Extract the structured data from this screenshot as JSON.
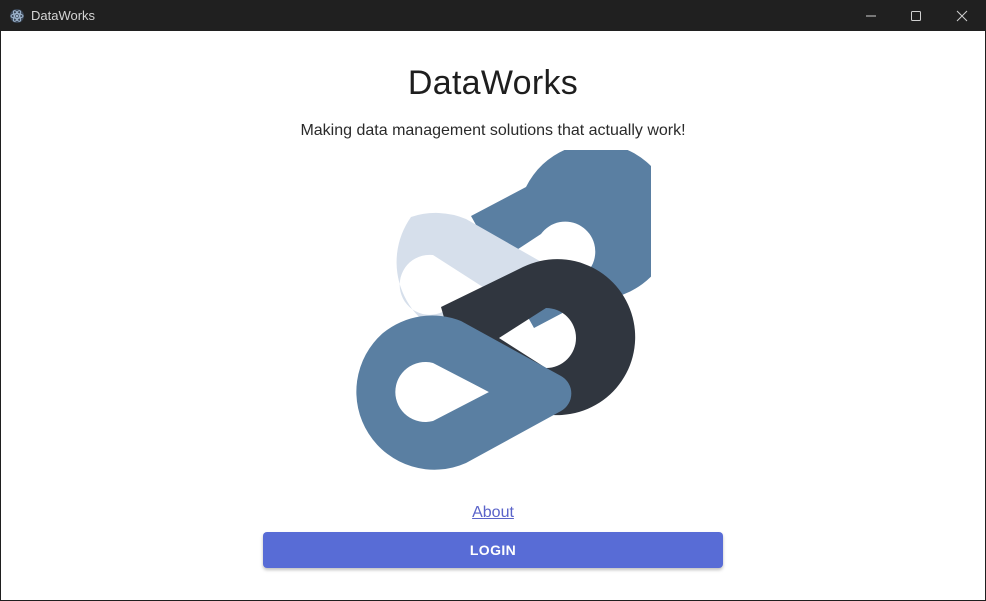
{
  "window": {
    "title": "DataWorks",
    "controls": [
      "minimize-icon",
      "maximize-icon",
      "close-icon"
    ]
  },
  "main": {
    "title": "DataWorks",
    "tagline": "Making data management solutions that actually work!",
    "about_link": "About",
    "login_label": "LOGIN"
  },
  "colors": {
    "accent": "#586cd6",
    "logo_steel": "#5a7fa2",
    "logo_light": "#d6dfeb",
    "logo_dark": "#30363f",
    "link": "#5a63c9"
  }
}
